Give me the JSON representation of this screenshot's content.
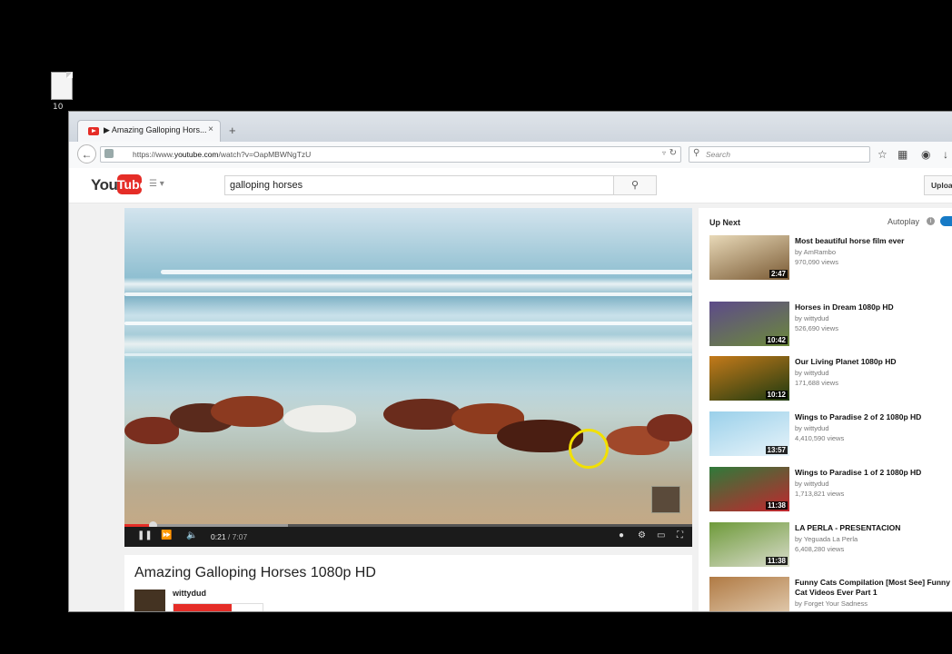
{
  "desktop": {
    "icon_label": "10"
  },
  "browser": {
    "tab_title": "▶ Amazing Galloping Hors...",
    "tab_close": "×",
    "new_tab": "+",
    "url_prefix": "https://www.",
    "url_host": "youtube.com",
    "url_path": "/watch?v=OapMBWNgTzU",
    "search_placeholder": "Search"
  },
  "youtube": {
    "logo_you": "You",
    "logo_tube": "Tube",
    "search_value": "galloping horses",
    "upload_label": "Upload"
  },
  "player": {
    "current_time": "0:21",
    "separator": " / ",
    "duration": "7:07",
    "progress_fraction": 0.05
  },
  "video": {
    "title": "Amazing Galloping Horses 1080p HD",
    "channel": "wittydud"
  },
  "sidebar": {
    "up_next": "Up Next",
    "autoplay": "Autoplay",
    "items": [
      {
        "title": "Most beautiful horse film ever",
        "channel": "by AmRambo",
        "views": "970,090 views",
        "duration": "2:47",
        "c1": "#e8d9b8",
        "c2": "#7a5a34"
      },
      {
        "title": "Horses in Dream 1080p HD",
        "channel": "by wittydud",
        "views": "526,690 views",
        "duration": "10:42",
        "c1": "#5d4a8a",
        "c2": "#6c8a3a"
      },
      {
        "title": "Our Living Planet 1080p HD",
        "channel": "by wittydud",
        "views": "171,688 views",
        "duration": "10:12",
        "c1": "#c47a1a",
        "c2": "#1e3a10"
      },
      {
        "title": "Wings to Paradise 2 of 2 1080p HD",
        "channel": "by wittydud",
        "views": "4,410,590 views",
        "duration": "13:57",
        "c1": "#9ad0ea",
        "c2": "#e8f4fa"
      },
      {
        "title": "Wings to Paradise 1 of 2 1080p HD",
        "channel": "by wittydud",
        "views": "1,713,821 views",
        "duration": "11:38",
        "c1": "#2f7a3a",
        "c2": "#c2262e"
      },
      {
        "title": "LA PERLA - PRESENTACION",
        "channel": "by Yeguada La Perla",
        "views": "6,408,280 views",
        "duration": "11:38",
        "c1": "#6e9a3a",
        "c2": "#d9dccb"
      },
      {
        "title": "Funny Cats Compilation [Most See] Funny Cat Videos Ever Part 1",
        "channel": "by Forget Your Sadness",
        "views": "",
        "duration": "",
        "c1": "#b07a44",
        "c2": "#e6d2b8"
      }
    ]
  }
}
